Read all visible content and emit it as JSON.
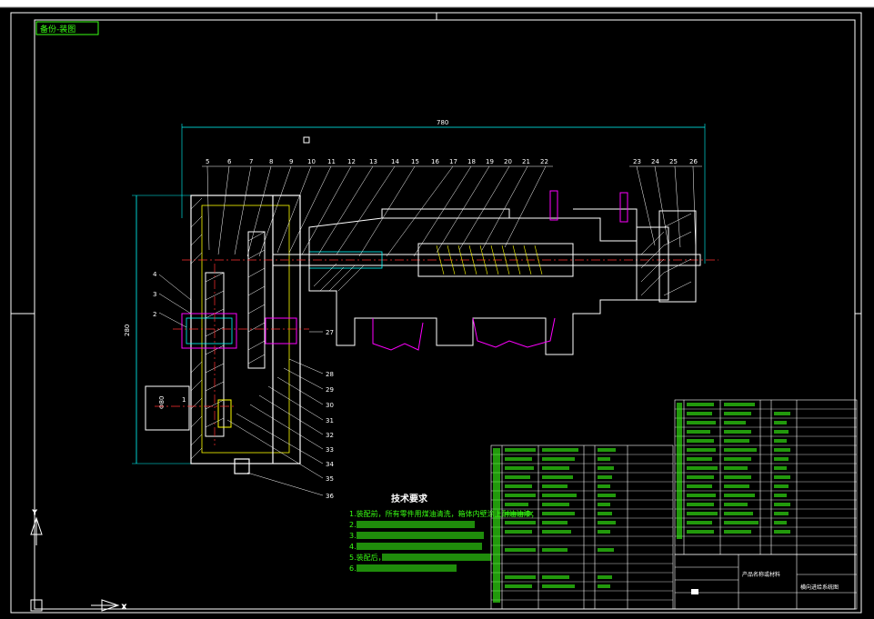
{
  "tag": "备份-装图",
  "dimension_top": "780",
  "dimension_left": "280",
  "dimension_small": "Φ80",
  "part_numbers_top": [
    "5",
    "6",
    "7",
    "8",
    "9",
    "10",
    "11",
    "12",
    "13",
    "14",
    "15",
    "16",
    "17",
    "18",
    "19",
    "20",
    "21",
    "22",
    "23",
    "24",
    "25",
    "26"
  ],
  "part_numbers_left": [
    "4",
    "3",
    "2",
    "1"
  ],
  "part_numbers_right": [
    "27",
    "28",
    "29",
    "30",
    "31",
    "32",
    "33",
    "34",
    "35",
    "36"
  ],
  "tech_title": "技术要求",
  "tech_lines": [
    "1.装配前，所有零件用煤油清洗，箱体内壁涂上耐油油漆；",
    "2.",
    "3.",
    "4.",
    "5.装配后，",
    "6."
  ],
  "title_block": {
    "product": "产品名称或材料",
    "drawing": "横向进给系统图"
  },
  "colors": {
    "background": "#000000",
    "lines": "#ffffff",
    "cyan": "#00ffff",
    "green": "#39ff14",
    "yellow": "#ffff00",
    "magenta": "#ff00ff",
    "red": "#ff3030"
  }
}
